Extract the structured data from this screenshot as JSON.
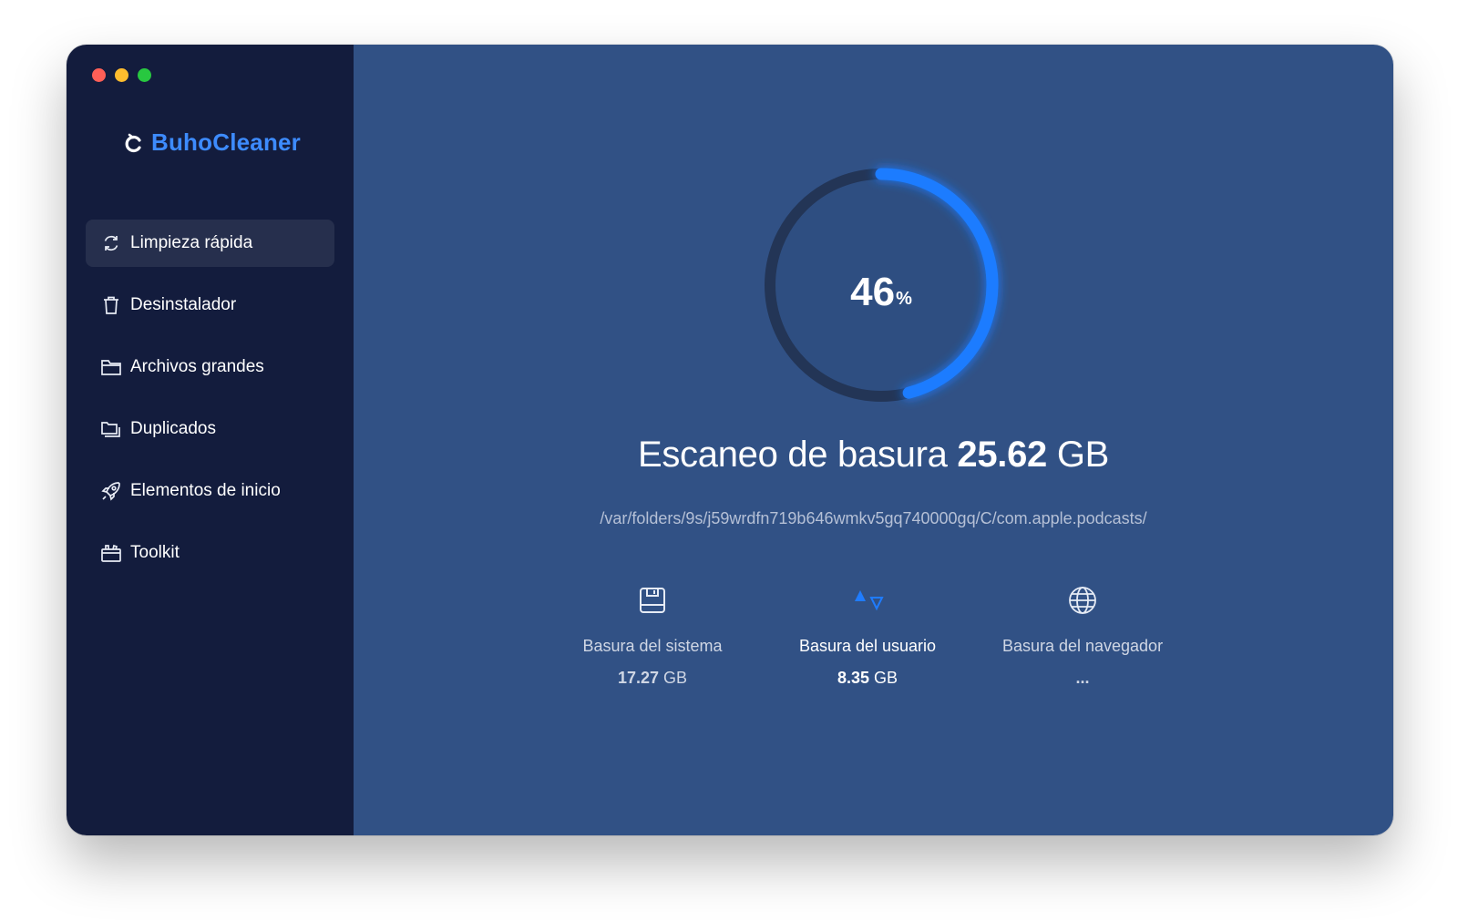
{
  "app": {
    "name": "BuhoCleaner",
    "accent": "#3d8bfd"
  },
  "sidebar": {
    "items": [
      {
        "label": "Limpieza rápida",
        "icon": "refresh-icon",
        "active": true
      },
      {
        "label": "Desinstalador",
        "icon": "trash-icon",
        "active": false
      },
      {
        "label": "Archivos grandes",
        "icon": "folder-icon",
        "active": false
      },
      {
        "label": "Duplicados",
        "icon": "duplicate-folders-icon",
        "active": false
      },
      {
        "label": "Elementos de inicio",
        "icon": "rocket-icon",
        "active": false
      },
      {
        "label": "Toolkit",
        "icon": "toolbox-icon",
        "active": false
      }
    ]
  },
  "scan": {
    "progress_percent": 46,
    "progress_number": "46",
    "progress_unit": "%",
    "title_prefix": "Escaneo de basura",
    "total_value": "25.62",
    "total_unit": "GB",
    "current_path": "/var/folders/9s/j59wrdfn719b646wmkv5gq740000gq/C/com.apple.podcasts/",
    "ring_colors": {
      "track": "#233556",
      "fill": "#1f7cff"
    }
  },
  "categories": [
    {
      "label": "Basura del sistema",
      "value": "17.27",
      "unit": "GB",
      "icon": "drive-icon"
    },
    {
      "label": "Basura del usuario",
      "value": "8.35",
      "unit": "GB",
      "icon": "shapes-icon"
    },
    {
      "label": "Basura del navegador",
      "value": "...",
      "unit": "",
      "icon": "globe-icon"
    }
  ]
}
